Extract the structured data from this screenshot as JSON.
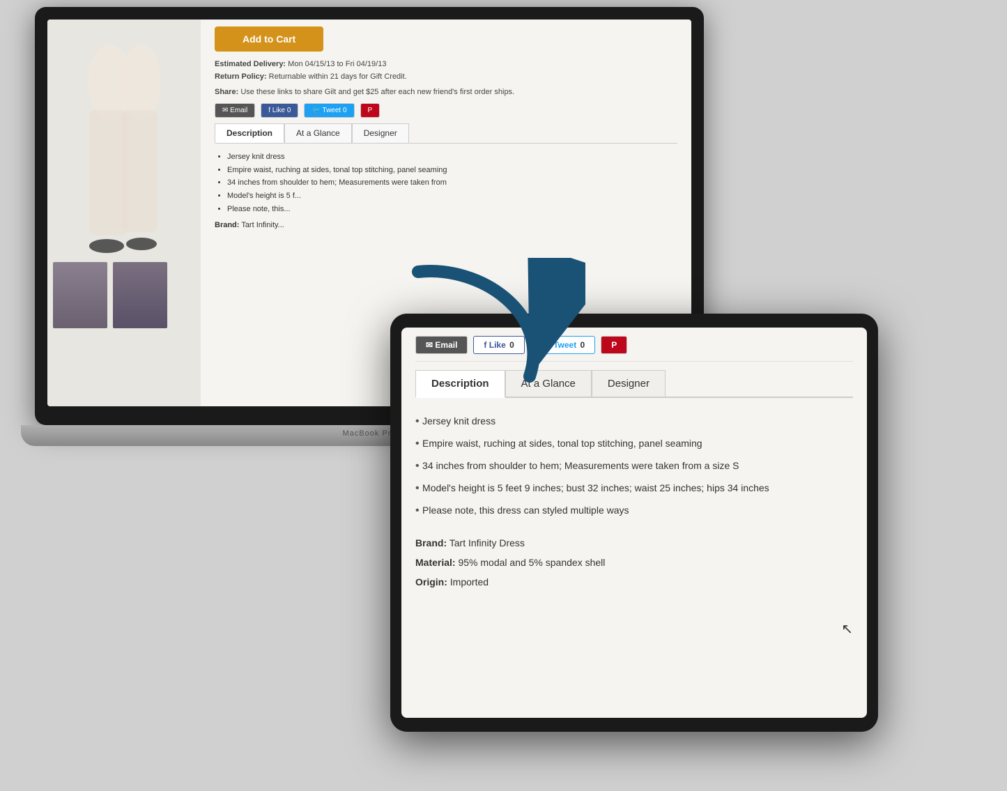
{
  "laptop": {
    "add_to_cart_label": "Add to Cart",
    "estimated_delivery_label": "Estimated Delivery:",
    "estimated_delivery_value": "Mon 04/15/13 to Fri 04/19/13",
    "return_policy_label": "Return Policy:",
    "return_policy_value": "Returnable within 21 days for Gift Credit.",
    "share_label": "Share:",
    "share_description": "Use these links to share Gilt and get $25 after each new friend's first order ships.",
    "social": {
      "email_label": "Email",
      "like_label": "Like",
      "like_count": "0",
      "tweet_label": "Tweet",
      "tweet_count": "0"
    },
    "tabs": [
      {
        "label": "Description",
        "active": true
      },
      {
        "label": "At a Glance",
        "active": false
      },
      {
        "label": "Designer",
        "active": false
      }
    ],
    "description_items": [
      "Jersey knit dress",
      "Empire waist, ruching at sides, tonal top stitching, panel seaming",
      "34 inches from shoulder to hem; Measurements were taken from",
      "Model's height is 5 f...",
      "Please note, this..."
    ],
    "brand_label": "Brand:",
    "brand_value": "Tart Infinity..."
  },
  "tablet": {
    "social": {
      "email_label": "Email",
      "like_label": "Like",
      "like_count": "0",
      "tweet_label": "Tweet",
      "tweet_count": "0"
    },
    "tabs": [
      {
        "label": "Description",
        "active": true
      },
      {
        "label": "At a Glance",
        "active": false
      },
      {
        "label": "Designer",
        "active": false
      }
    ],
    "description_items": [
      "Jersey knit dress",
      "Empire waist, ruching at sides, tonal top stitching, panel seaming",
      "34 inches from shoulder to hem; Measurements were taken from a size S",
      "Model's height is 5 feet 9 inches; bust 32 inches; waist 25 inches; hips 34 inches",
      "Please note, this dress can styled multiple ways"
    ],
    "brand_label": "Brand:",
    "brand_value": "Tart Infinity Dress",
    "material_label": "Material:",
    "material_value": "95% modal and 5% spandex shell",
    "origin_label": "Origin:",
    "origin_value": "Imported"
  }
}
